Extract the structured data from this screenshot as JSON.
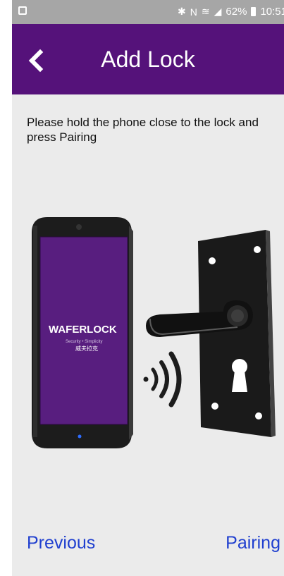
{
  "status_bar": {
    "battery": "62%",
    "time": "10:51",
    "icons": [
      "screenshot-icon",
      "bluetooth-icon",
      "nfc-icon",
      "wifi-icon",
      "signal-icon",
      "battery-icon"
    ]
  },
  "header": {
    "title": "Add Lock",
    "background": "#55127a"
  },
  "instruction": "Please hold the phone close to the lock and press Pairing",
  "illustration": {
    "brand": "WAFERLOCK",
    "tagline": "Security • Simplicity",
    "chinese_name": "威夫拉克"
  },
  "footer": {
    "previous_label": "Previous",
    "pairing_label": "Pairing",
    "link_color": "#1f3fcf"
  }
}
